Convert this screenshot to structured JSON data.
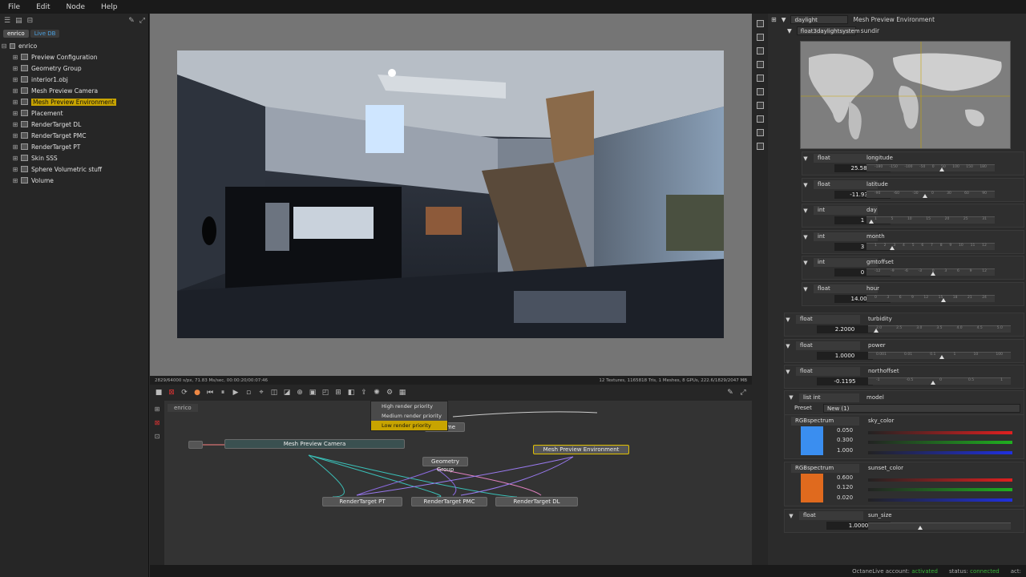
{
  "menu": [
    "File",
    "Edit",
    "Node",
    "Help"
  ],
  "outliner": {
    "tabs": [
      "enrico",
      "Live DB"
    ],
    "root": "enrico",
    "items": [
      {
        "label": "Preview Configuration",
        "selected": false
      },
      {
        "label": "Geometry Group",
        "selected": false
      },
      {
        "label": "interior1.obj",
        "selected": false
      },
      {
        "label": "Mesh Preview Camera",
        "selected": false
      },
      {
        "label": "Mesh Preview Environment",
        "selected": true
      },
      {
        "label": "Placement",
        "selected": false
      },
      {
        "label": "RenderTarget DL",
        "selected": false
      },
      {
        "label": "RenderTarget PMC",
        "selected": false
      },
      {
        "label": "RenderTarget PT",
        "selected": false
      },
      {
        "label": "Skin SSS",
        "selected": false
      },
      {
        "label": "Sphere Volumetric stuff",
        "selected": false
      },
      {
        "label": "Volume",
        "selected": false
      }
    ]
  },
  "render_status": {
    "left": "2829/64000 s/px, 71.83 Ms/sec, 00:00:20/00:07:46",
    "right": "12 Textures, 1165818 Tris, 1 Meshes, 8 GPUs, 222.6/1829/2047 MB"
  },
  "nodegraph": {
    "tab": "enrico",
    "context_menu": [
      {
        "label": "High render priority",
        "highlighted": false
      },
      {
        "label": "Medium render priority",
        "highlighted": false
      },
      {
        "label": "Low render priority",
        "highlighted": true
      }
    ],
    "nodes": [
      "Mesh Preview Camera",
      "Volume",
      "Geometry Group",
      "Mesh Preview Environment",
      "RenderTarget PT",
      "RenderTarget PMC",
      "RenderTarget DL"
    ]
  },
  "inspector": {
    "header_dropdown": "daylight",
    "header_title": "Mesh Preview Environment",
    "sun_type": "float3daylightsystem",
    "sun_label": "sundir",
    "params": [
      {
        "type": "float",
        "name": "longitude",
        "value": "25.5837",
        "ticks": [
          "-180",
          "-150",
          "-100",
          "-50",
          "0",
          "50",
          "100",
          "150",
          "180"
        ],
        "level": 0.57
      },
      {
        "type": "float",
        "name": "latitude",
        "value": "-11.9388",
        "ticks": [
          "-90",
          "-60",
          "-30",
          "0",
          "30",
          "60",
          "90"
        ],
        "level": 0.44
      },
      {
        "type": "int",
        "name": "day",
        "value": "1",
        "ticks": [
          "1",
          "5",
          "10",
          "15",
          "20",
          "25",
          "31"
        ],
        "level": 0.02
      },
      {
        "type": "int",
        "name": "month",
        "value": "3",
        "ticks": [
          "1",
          "2",
          "3",
          "4",
          "5",
          "6",
          "7",
          "8",
          "9",
          "10",
          "11",
          "12"
        ],
        "level": 0.18
      },
      {
        "type": "int",
        "name": "gmtoffset",
        "value": "0",
        "ticks": [
          "-12",
          "-9",
          "-6",
          "-3",
          "0",
          "3",
          "6",
          "9",
          "12"
        ],
        "level": 0.5
      },
      {
        "type": "float",
        "name": "hour",
        "value": "14.0000",
        "ticks": [
          "0",
          "3",
          "6",
          "9",
          "12",
          "15",
          "18",
          "21",
          "24"
        ],
        "level": 0.58
      }
    ],
    "params2": [
      {
        "type": "float",
        "name": "turbidity",
        "value": "2.2000",
        "ticks": [
          "2.0",
          "2.5",
          "3.0",
          "3.5",
          "4.0",
          "4.5",
          "5.0"
        ],
        "level": 0.04
      },
      {
        "type": "float",
        "name": "power",
        "value": "1.0000",
        "ticks": [
          "0.001",
          "0.01",
          "0.1",
          "1",
          "10",
          "100"
        ],
        "level": 0.5
      },
      {
        "type": "float",
        "name": "northoffset",
        "value": "-0.1195",
        "ticks": [
          "-1",
          "-0.5",
          "0",
          "0.5",
          "1"
        ],
        "level": 0.44
      }
    ],
    "model": {
      "type": "list int",
      "name": "model",
      "preset_label": "Preset",
      "preset_value": "New (1)"
    },
    "sky_color": {
      "type": "RGBspectrum",
      "name": "sky_color",
      "values": [
        "0.050",
        "0.300",
        "1.000"
      ],
      "color": "#3a8ef0"
    },
    "sunset_color": {
      "type": "RGBspectrum",
      "name": "sunset_color",
      "values": [
        "0.600",
        "0.120",
        "0.020"
      ],
      "color": "#e06a1e"
    },
    "sun_size": {
      "type": "float",
      "name": "sun_size",
      "value": "1.0000",
      "level": 0.35
    }
  },
  "footer": {
    "account_label": "OctaneLive account:",
    "account_value": "activated",
    "status_label": "status:",
    "status_value": "connected",
    "act_label": "act:"
  },
  "colors": {
    "accent": "#c8a400",
    "active": "#3ab53a",
    "sky": "#3a8ef0",
    "sunset": "#e06a1e"
  }
}
